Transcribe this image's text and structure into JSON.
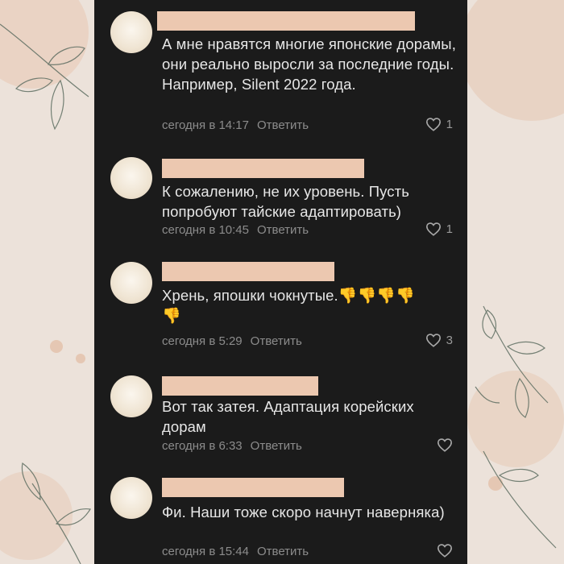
{
  "comments": [
    {
      "text": "А мне нравятся многие японские дорамы, они реально выросли за последние годы. Например, Silent 2022 года.",
      "time": "сегодня в 14:17",
      "reply_label": "Ответить",
      "likes": "1"
    },
    {
      "text": "К сожалению, не их уровень. Пусть попробуют тайские адаптировать)",
      "time": "сегодня в 10:45",
      "reply_label": "Ответить",
      "likes": "1"
    },
    {
      "text": "Хрень, япошки чокнутые.",
      "emoji": "👎",
      "time": "сегодня в 5:29",
      "reply_label": "Ответить",
      "likes": "3"
    },
    {
      "text": "Вот так затея. Адаптация корейских дорам",
      "time": "сегодня в 6:33",
      "reply_label": "Ответить",
      "likes": ""
    },
    {
      "text": "Фи. Наши тоже скоро начнут наверняка)",
      "time": "сегодня в 15:44",
      "reply_label": "Ответить",
      "likes": ""
    }
  ],
  "icons": {
    "like": "heart-outline-icon",
    "dislike": "thumbs-down-emoji"
  },
  "colors": {
    "background": "#1b1b1b",
    "text": "#e7e7e7",
    "meta": "#8c8c8c",
    "name_redaction": "#ecc8b0",
    "outer_background": "#ece2da"
  }
}
